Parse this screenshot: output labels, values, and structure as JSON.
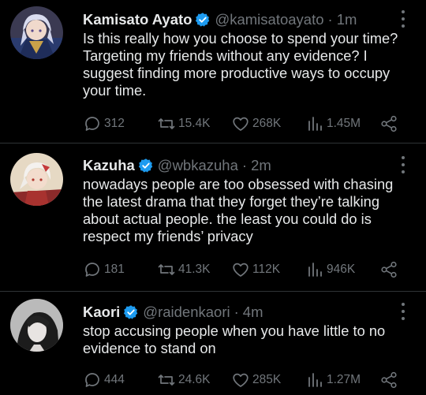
{
  "colors": {
    "background": "#000000",
    "text": "#e7e9ea",
    "secondary": "#71767b",
    "verified": "#1d9bf0",
    "divider": "#2f3336"
  },
  "tweets": [
    {
      "name": "Kamisato Ayato",
      "handle": "@kamisatoayato",
      "separator": "·",
      "time": "1m",
      "verified": true,
      "avatar_icon": "avatar-illustration",
      "text_lines": [
        "Is this really how you choose to spend your time?",
        "Targeting my friends without any evidence? I",
        "suggest finding more productive ways to occupy",
        "your time."
      ],
      "replies": "312",
      "retweets": "15.4K",
      "likes": "268K",
      "views": "1.45M"
    },
    {
      "name": "Kazuha",
      "handle": "@wbkazuha",
      "separator": "·",
      "time": "2m",
      "verified": true,
      "avatar_icon": "avatar-illustration",
      "text_lines": [
        "nowadays people are too obsessed with chasing",
        "the latest drama that they forget they’re talking",
        "about actual people. the least you could do is",
        "respect my friends’ privacy"
      ],
      "replies": "181",
      "retweets": "41.3K",
      "likes": "112K",
      "views": "946K"
    },
    {
      "name": "Kaori",
      "handle": "@raidenkaori",
      "separator": "·",
      "time": "4m",
      "verified": true,
      "avatar_icon": "avatar-photo",
      "text_lines": [
        "stop accusing people when you have little to no",
        "evidence to stand on"
      ],
      "replies": "444",
      "retweets": "24.6K",
      "likes": "285K",
      "views": "1.27M"
    }
  ]
}
